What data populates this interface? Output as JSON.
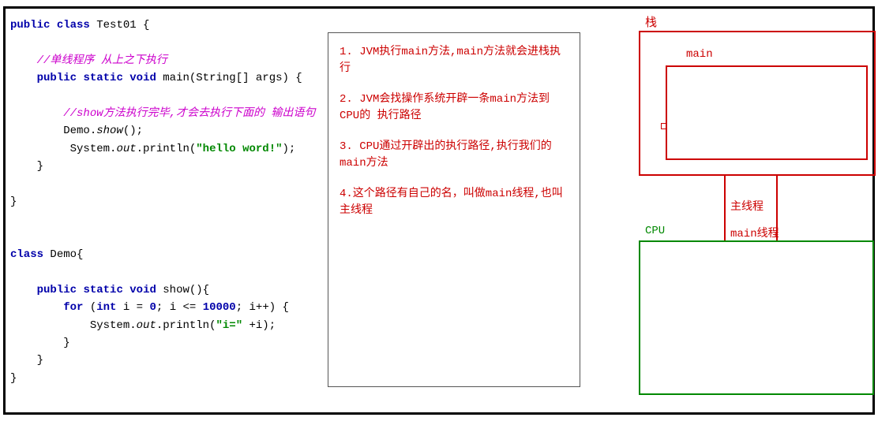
{
  "code": {
    "l1a": "public",
    "l1b": "class",
    "l1c": " Test01 {",
    "l2": "//单线程序 从上之下执行",
    "l3a": "public",
    "l3b": "static",
    "l3c": "void",
    "l3d": " main(String[] args) {",
    "l4": "//show方法执行完毕,才会去执行下面的 输出语句",
    "l5a": "Demo.",
    "l5b": "show",
    "l5c": "();",
    "l6a": "System.",
    "l6b": "out",
    "l6c": ".println(",
    "l6d": "\"hello word!\"",
    "l6e": ");",
    "l7": "}",
    "l8": "}",
    "l9a": "class",
    "l9b": " Demo{",
    "l10a": "public",
    "l10b": "static",
    "l10c": "void",
    "l10d": " show(){",
    "l11a": "for",
    "l11b": " (",
    "l11c": "int",
    "l11d": " i = ",
    "l11e": "0",
    "l11f": "; i <= ",
    "l11g": "10000",
    "l11h": "; i++) {",
    "l12a": "System.",
    "l12b": "out",
    "l12c": ".println(",
    "l12d": "\"i=\"",
    "l12e": " +i);",
    "l13": "}",
    "l14": "}",
    "l15": "}"
  },
  "notes": {
    "n1": "1. JVM执行main方法,main方法就会进栈执行",
    "n2": "2. JVM会找操作系统开辟一条main方法到CPU的 执行路径",
    "n3": "3. CPU通过开辟出的执行路径,执行我们的main方法",
    "n4": "4.这个路径有自己的名，叫做main线程,也叫主线程"
  },
  "diagram": {
    "stack": "栈",
    "main": "main",
    "main_thread": "主线程",
    "cpu": "CPU",
    "cpu_thread": "main线程"
  }
}
